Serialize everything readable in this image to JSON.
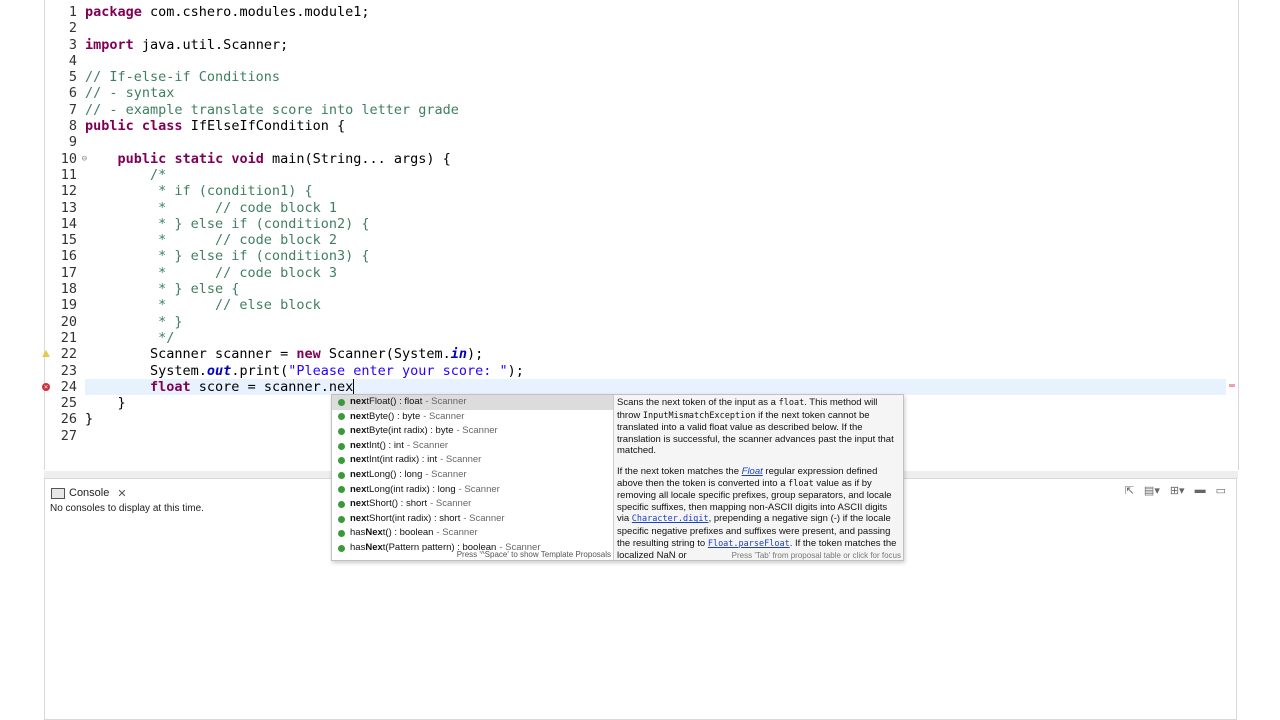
{
  "editor": {
    "line_numbers": [
      "1",
      "2",
      "3",
      "4",
      "5",
      "6",
      "7",
      "8",
      "9",
      "10",
      "11",
      "12",
      "13",
      "14",
      "15",
      "16",
      "17",
      "18",
      "19",
      "20",
      "21",
      "22",
      "23",
      "24",
      "25",
      "26",
      "27"
    ],
    "lines": [
      "package com.cshero.modules.module1;",
      "",
      "import java.util.Scanner;",
      "",
      "// If-else-if Conditions",
      "// - syntax",
      "// - example translate score into letter grade",
      "public class IfElseIfCondition {",
      "",
      "    public static void main(String... args) {",
      "        /*",
      "         * if (condition1) {",
      "         *      // code block 1",
      "         * } else if (condition2) {",
      "         *      // code block 2",
      "         * } else if (condition3) {",
      "         *      // code block 3",
      "         * } else {",
      "         *      // else block",
      "         * }",
      "         */",
      "        Scanner scanner = new Scanner(System.in);",
      "        System.out.print(\"Please enter your score: \");",
      "        float score = scanner.nex",
      "    }",
      "}",
      ""
    ],
    "current_line": 24
  },
  "console": {
    "tab_label": "Console",
    "message": "No consoles to display at this time."
  },
  "proposals": {
    "items": [
      {
        "prefix": "nex",
        "rest": "tFloat() : float",
        "type": "- Scanner",
        "selected": true
      },
      {
        "prefix": "nex",
        "rest": "tByte() : byte",
        "type": "- Scanner"
      },
      {
        "prefix": "nex",
        "rest": "tByte(int radix) : byte",
        "type": "- Scanner"
      },
      {
        "prefix": "nex",
        "rest": "tInt() : int",
        "type": "- Scanner"
      },
      {
        "prefix": "nex",
        "rest": "tInt(int radix) : int",
        "type": "- Scanner"
      },
      {
        "prefix": "nex",
        "rest": "tLong() : long",
        "type": "- Scanner"
      },
      {
        "prefix": "nex",
        "rest": "tLong(int radix) : long",
        "type": "- Scanner"
      },
      {
        "prefix": "nex",
        "rest": "tShort() : short",
        "type": "- Scanner"
      },
      {
        "prefix": "nex",
        "rest": "tShort(int radix) : short",
        "type": "- Scanner"
      },
      {
        "prefix": "has",
        "bold_mid": "Nex",
        "rest": "t() : boolean",
        "type": "- Scanner"
      },
      {
        "prefix": "has",
        "bold_mid": "Nex",
        "rest": "t(Pattern pattern) : boolean",
        "type": "- Scanner"
      }
    ],
    "footer": "Press '^Space' to show Template Proposals",
    "doc": {
      "p1_a": "Scans the next token of the input as a ",
      "p1_code1": "float",
      "p1_b": ". This method will throw ",
      "p1_code2": "InputMismatchException",
      "p1_c": " if the next token cannot be translated into a valid float value as described below. If the translation is successful, the scanner advances past the input that matched.",
      "p2_a": "If the next token matches the ",
      "p2_link1": "Float",
      "p2_b": " regular expression defined above then the token is converted into a ",
      "p2_code1": "float",
      "p2_c": " value as if by removing all locale specific prefixes, group separators, and locale specific suffixes, then mapping non-ASCII digits into ASCII digits via ",
      "p2_link2": "Character.digit",
      "p2_d": ", prepending a negative sign (-) if the locale specific negative prefixes and suffixes were present, and passing the resulting string to ",
      "p2_link3": "Float.parseFloat",
      "p2_e": ". If the token matches the localized NaN or",
      "footer": "Press 'Tab' from proposal table or click for focus"
    }
  }
}
